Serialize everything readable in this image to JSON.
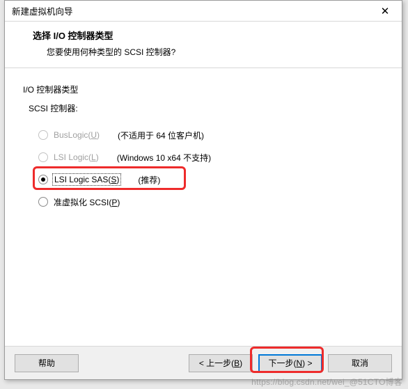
{
  "window": {
    "title": "新建虚拟机向导",
    "close_glyph": "✕"
  },
  "header": {
    "heading": "选择 I/O 控制器类型",
    "subheading": "您要使用何种类型的 SCSI 控制器?"
  },
  "section": {
    "label": "I/O 控制器类型",
    "sub_label": "SCSI 控制器:"
  },
  "options": [
    {
      "label_pre": "BusLogic(",
      "mnemonic": "U",
      "label_post": ")",
      "hint": "(不适用于 64 位客户机)",
      "enabled": false,
      "checked": false
    },
    {
      "label_pre": "LSI Logic(",
      "mnemonic": "L",
      "label_post": ")",
      "hint": "(Windows 10 x64 不支持)",
      "enabled": false,
      "checked": false
    },
    {
      "label_pre": "LSI Logic SAS(",
      "mnemonic": "S",
      "label_post": ")",
      "hint": "(推荐)",
      "enabled": true,
      "checked": true
    },
    {
      "label_pre": "准虚拟化 SCSI(",
      "mnemonic": "P",
      "label_post": ")",
      "hint": "",
      "enabled": true,
      "checked": false
    }
  ],
  "footer": {
    "help": "帮助",
    "back_pre": "< 上一步(",
    "back_mn": "B",
    "back_post": ")",
    "next_pre": "下一步(",
    "next_mn": "N",
    "next_post": ") >",
    "cancel": "取消"
  },
  "watermark": "https://blog.csdn.net/wei_@51CTO博客"
}
